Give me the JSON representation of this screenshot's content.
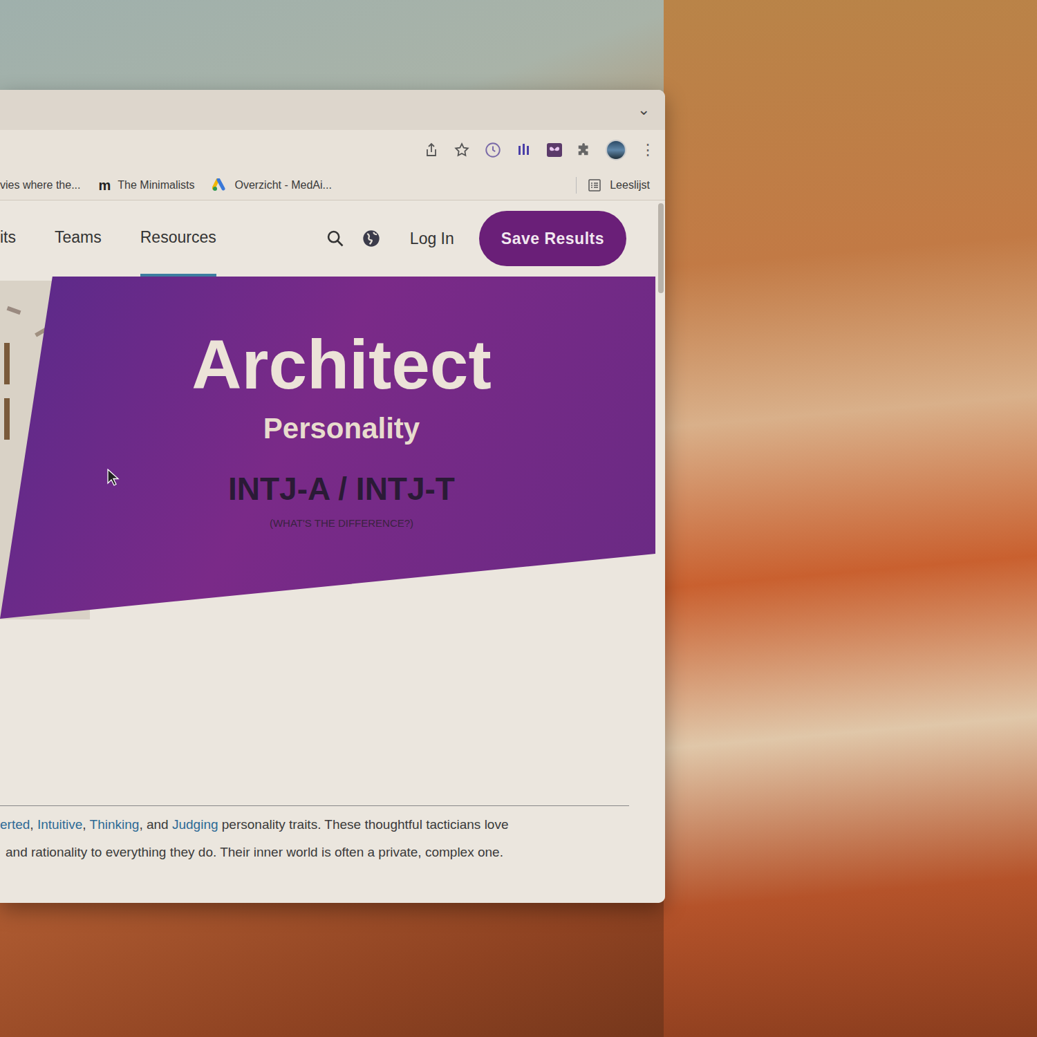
{
  "browser": {
    "tab_strip_chevron": "⌄",
    "menu": "⋮"
  },
  "bookmarks": [
    {
      "label": "vies where the...",
      "icon": ""
    },
    {
      "label": "The Minimalists",
      "icon": "m"
    },
    {
      "label": "Overzicht - MedAi...",
      "icon": ""
    }
  ],
  "reading_list": "Leeslijst",
  "nav": {
    "items": [
      {
        "label": "its",
        "selected": false
      },
      {
        "label": "Teams",
        "selected": false
      },
      {
        "label": "Resources",
        "selected": true
      }
    ],
    "login": "Log In",
    "save": "Save Results"
  },
  "hero": {
    "title": "Architect",
    "subtitle": "Personality",
    "types": "INTJ-A / INTJ-T",
    "difference": "(WHAT'S THE DIFFERENCE?)"
  },
  "intro": {
    "lines": [
      [
        {
          "text": "erted",
          "link": true
        },
        {
          "text": ", ",
          "link": false
        },
        {
          "text": "Intuitive",
          "link": true
        },
        {
          "text": ", ",
          "link": false
        },
        {
          "text": "Thinking",
          "link": true
        },
        {
          "text": ", and ",
          "link": false
        },
        {
          "text": "Judging",
          "link": true
        },
        {
          "text": " personality traits. These thoughtful tacticians love",
          "link": false
        }
      ],
      [
        {
          "text": "and rationality to everything they do. Their inner world is often a private, complex one.",
          "link": false
        }
      ]
    ]
  }
}
